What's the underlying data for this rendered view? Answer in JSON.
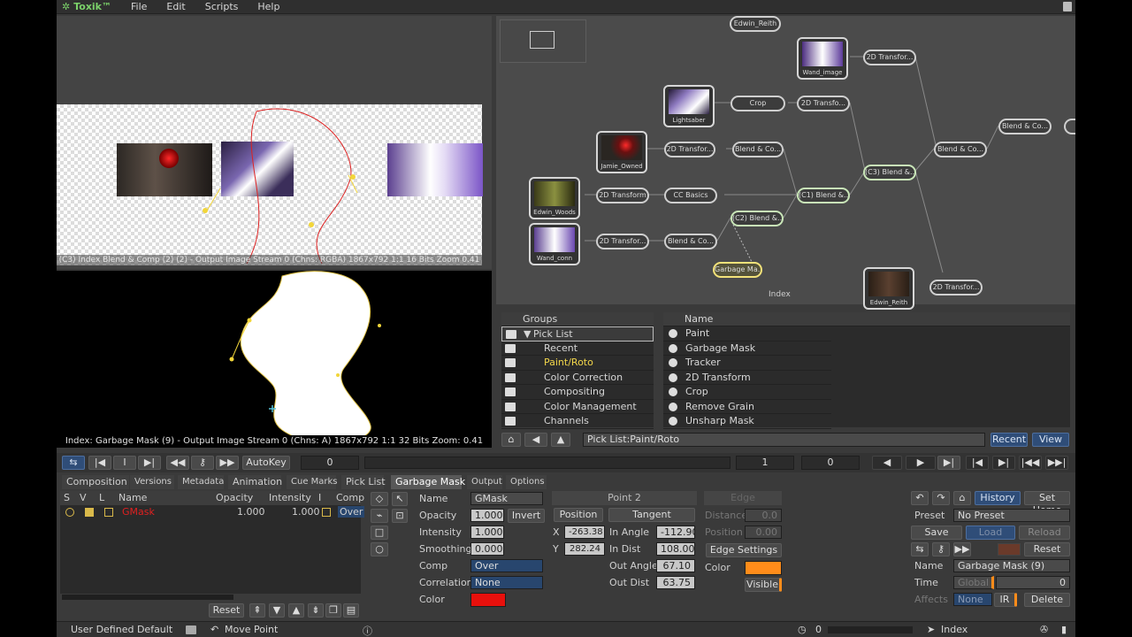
{
  "app": {
    "title": "Toxik™",
    "menu": [
      "File",
      "Edit",
      "Scripts",
      "Help"
    ]
  },
  "viewer_top": {
    "status": "(C3) Index Blend & Comp (2) (2) - Output Image  Stream 0 (Chns: RGBA)  1867x792  1:1  16 Bits  Zoom 0.41"
  },
  "viewer_bottom": {
    "status": "Index: Garbage Mask (9) - Output Image  Stream 0 (Chns: A)  1867x792  1:1  32 Bits  Zoom: 0.41"
  },
  "nodegraph": {
    "index_label": "Index",
    "thumb_nodes": [
      "Wand_image",
      "Lightsaber",
      "Jamie_Owned",
      "Edwin_Woods",
      "Wand_conn",
      "Edwin_Reith"
    ],
    "nodes": [
      "Edwin_Reith",
      "2D Transfor...",
      "Crop",
      "2D Transfo...",
      "2D Transfor...",
      "Blend & Co...",
      "Blend & Co...",
      "2D Transform",
      "CC Basics",
      "(C1) Blend &...",
      "(C3) Blend &...",
      "(C2) Blend &...",
      "2D Transfor...",
      "Blend & Co...",
      "Garbage Ma...",
      "Blend & Co...",
      "2D Transfor..."
    ]
  },
  "groups": {
    "header": "Groups",
    "items": [
      {
        "label": "Pick List",
        "style": "hl"
      },
      {
        "label": "Recent",
        "style": ""
      },
      {
        "label": "Paint/Roto",
        "style": "yellow"
      },
      {
        "label": "Color Correction",
        "style": ""
      },
      {
        "label": "Compositing",
        "style": ""
      },
      {
        "label": "Color Management",
        "style": ""
      },
      {
        "label": "Channels",
        "style": ""
      }
    ]
  },
  "names": {
    "header": "Name",
    "items": [
      "Paint",
      "Garbage Mask",
      "Tracker",
      "2D Transform",
      "Crop",
      "Remove Grain",
      "Unsharp Mask"
    ]
  },
  "browser_bar": {
    "path": "Pick List:Paint/Roto",
    "recent": "Recent",
    "view": "View"
  },
  "timeline": {
    "autokey": "AutoKey",
    "frame": "0",
    "start": "1",
    "end": "0"
  },
  "tabs": [
    "Composition",
    "Versions",
    "Metadata",
    "Animation",
    "Cue Marks",
    "Pick List",
    "Garbage Mask",
    "Output",
    "Options"
  ],
  "layers": {
    "columns": [
      "S",
      "V",
      "L",
      "Name",
      "Opacity",
      "Intensity",
      "I",
      "Comp"
    ],
    "row": {
      "name": "GMask",
      "opacity": "1.000",
      "intensity": "1.000",
      "comp": "Over"
    },
    "reset": "Reset"
  },
  "props": {
    "name_label": "Name",
    "name_value": "GMask",
    "opacity_label": "Opacity",
    "opacity_value": "1.000",
    "invert": "Invert",
    "intensity_label": "Intensity",
    "intensity_value": "1.000",
    "smoothing_label": "Smoothing",
    "smoothing_value": "0.000",
    "comp_label": "Comp",
    "comp_value": "Over",
    "correlation_label": "Correlation",
    "correlation_value": "None",
    "color_label": "Color",
    "color_hex": "#e8100c"
  },
  "point": {
    "title": "Point 2",
    "position": "Position",
    "tangent": "Tangent",
    "x_label": "X",
    "x_value": "-263.38",
    "y_label": "Y",
    "y_value": "282.24",
    "in_angle_label": "In Angle",
    "in_angle_value": "-112.90",
    "in_dist_label": "In Dist",
    "in_dist_value": "108.00",
    "out_angle_label": "Out Angle",
    "out_angle_value": "67.10",
    "out_dist_label": "Out Dist",
    "out_dist_value": "63.75"
  },
  "edge": {
    "title": "Edge",
    "distance_label": "Distance",
    "distance_value": "0.0",
    "position_label": "Position",
    "position_value": "0.00",
    "settings": "Edge Settings",
    "color_label": "Color",
    "color_hex": "#ff8c1a",
    "visible": "Visible"
  },
  "right_panel": {
    "history": "History",
    "set_home": "Set Home",
    "preset_label": "Preset",
    "preset_value": "No Preset",
    "save": "Save",
    "load": "Load",
    "reload": "Reload",
    "reset": "Reset",
    "name_label": "Name",
    "name_value": "Garbage Mask (9)",
    "time_label": "Time",
    "time_mode": "Global",
    "time_value": "0",
    "affects_label": "Affects",
    "affects_value": "None",
    "ir": "IR",
    "delete": "Delete"
  },
  "statusbar": {
    "preset": "User Defined Default",
    "tool": "Move Point",
    "frame": "0",
    "index": "Index"
  }
}
